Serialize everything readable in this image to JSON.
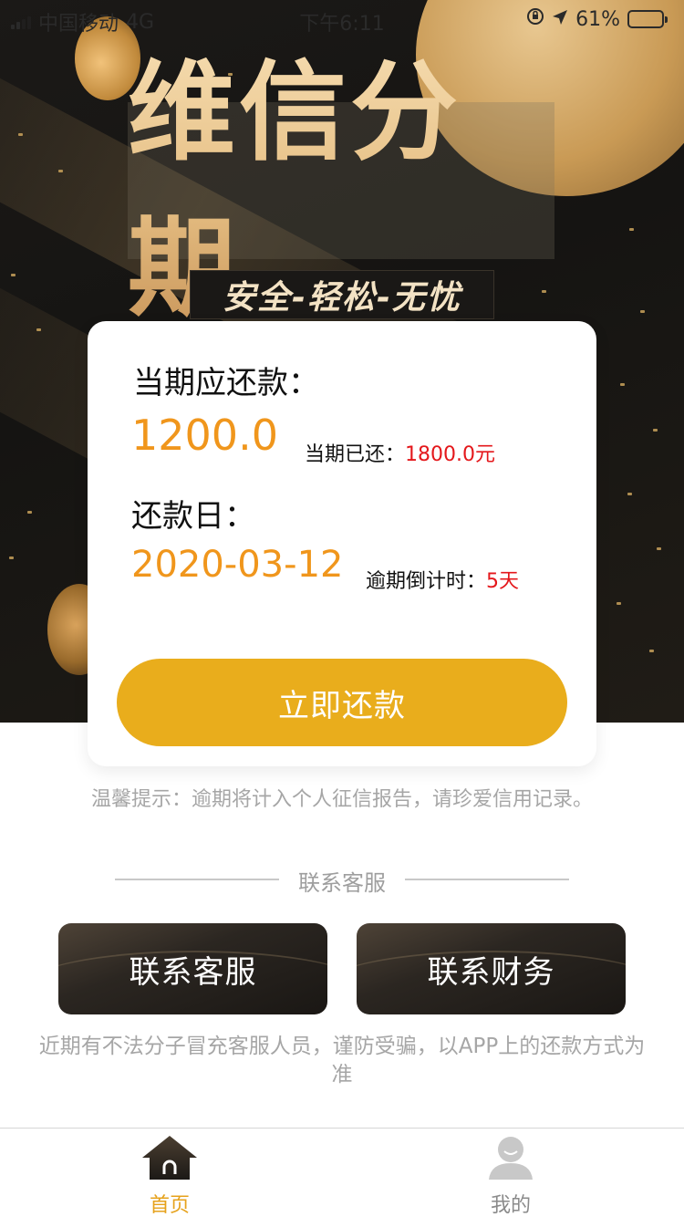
{
  "status_bar": {
    "carrier": "中国移动",
    "network": "4G",
    "time": "下午6:11",
    "battery": "61%",
    "battery_level": 0.61
  },
  "hero": {
    "title": "维信分期",
    "slogan": "安全-轻松-无忧"
  },
  "card": {
    "due_label": "当期应还款：",
    "due_amount": "1200.0",
    "paid_label": "当期已还：",
    "paid_amount": "1800.0元",
    "date_label": "还款日：",
    "due_date": "2020-03-12",
    "countdown_label": "逾期倒计时：",
    "countdown_value": "5天",
    "pay_button": "立即还款"
  },
  "tip": "温馨提示：逾期将计入个人征信报告，请珍爱信用记录。",
  "contact": {
    "section_title": "联系客服",
    "customer_service_button": "联系客服",
    "finance_button": "联系财务",
    "warning": "近期有不法分子冒充客服人员，谨防受骗，以APP上的还款方式为准"
  },
  "tabbar": {
    "home_label": "首页",
    "mine_label": "我的",
    "active_color": "#e6a21c",
    "inactive_color": "#8a8a8a"
  },
  "colors": {
    "accent_orange": "#f0961c",
    "alert_red": "#e4171b",
    "button_gold": "#e9ad1c"
  }
}
